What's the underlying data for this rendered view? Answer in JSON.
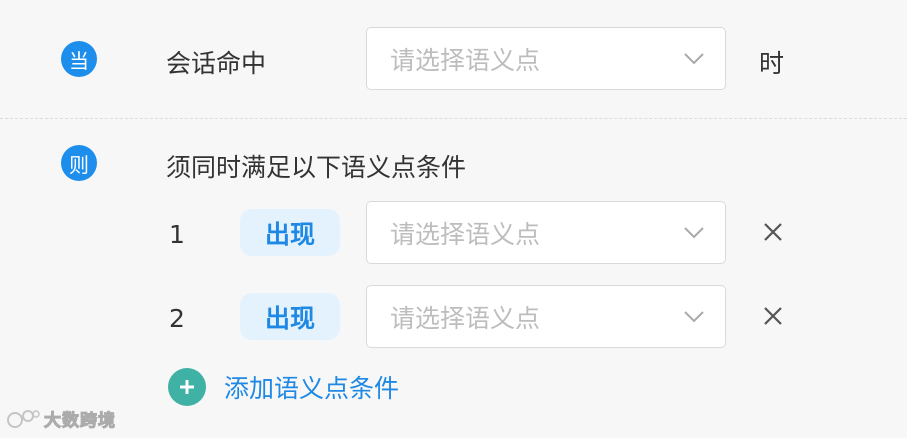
{
  "when": {
    "badge": "当",
    "label": "会话命中",
    "select_placeholder": "请选择语义点",
    "suffix": "时"
  },
  "then": {
    "badge": "则",
    "label": "须同时满足以下语义点条件",
    "conditions": [
      {
        "index": "1",
        "tag": "出现",
        "select_placeholder": "请选择语义点",
        "remove": "X"
      },
      {
        "index": "2",
        "tag": "出现",
        "select_placeholder": "请选择语义点",
        "remove": "X"
      }
    ],
    "add_label": "添加语义点条件"
  },
  "watermark": {
    "text": "大数跨境"
  },
  "icons": {
    "dropdown": "chevron-down-icon",
    "remove": "close-icon",
    "add": "plus-circle-icon"
  },
  "colors": {
    "badge": "#1e8eed",
    "tag_bg": "#e3f2fd",
    "tag_text": "#1e88e5",
    "add_icon": "#3fb1a5",
    "link": "#1e88e5",
    "placeholder": "#bdbdbd"
  }
}
